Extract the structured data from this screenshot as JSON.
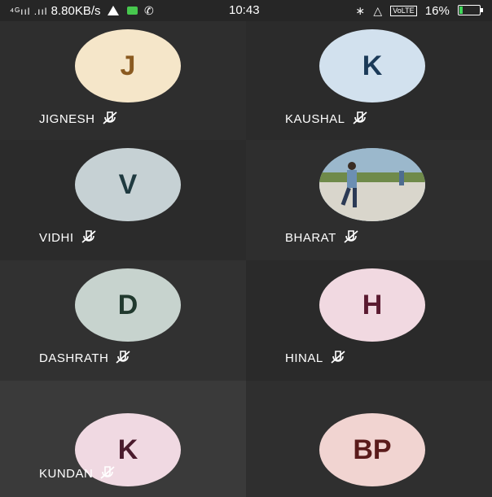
{
  "status_bar": {
    "signal_text": "⁴ᴳııl .ııl",
    "speed": "8.80KB/s",
    "time": "10:43",
    "volte": "VoLTE",
    "battery": "16%",
    "battery_level": 0.16,
    "icons": [
      "signal-icon",
      "warning-icon",
      "message-icon",
      "phone-icon",
      "bluetooth-icon",
      "mute-icon",
      "battery-icon"
    ]
  },
  "colors": {
    "dark_tile": "#2f2f2f",
    "darker_tile": "#2a2a2a"
  },
  "participants": [
    {
      "name": "JIGNESH",
      "initials": "J",
      "avatar_bg": "#f5e6c9",
      "avatar_fg": "#8a5a20",
      "tile_bg": "#2e2e2e",
      "muted": true
    },
    {
      "name": "KAUSHAL",
      "initials": "K",
      "avatar_bg": "#d2e1ee",
      "avatar_fg": "#1b3a58",
      "tile_bg": "#2b2b2b",
      "muted": true
    },
    {
      "name": "VIDHI",
      "initials": "V",
      "avatar_bg": "#c6d1d4",
      "avatar_fg": "#1f3a40",
      "tile_bg": "#2b2b2b",
      "muted": true
    },
    {
      "name": "BHARAT",
      "initials": "",
      "avatar_bg": "#87a7bd",
      "avatar_fg": "#ffffff",
      "tile_bg": "#2e2e2e",
      "muted": true,
      "photo": true
    },
    {
      "name": "DASHRATH",
      "initials": "D",
      "avatar_bg": "#c7d3ce",
      "avatar_fg": "#21392e",
      "tile_bg": "#313131",
      "muted": true
    },
    {
      "name": "HINAL",
      "initials": "H",
      "avatar_bg": "#f1d9e1",
      "avatar_fg": "#5a1a30",
      "tile_bg": "#2a2a2a",
      "muted": true
    },
    {
      "name": "KUNDAN",
      "initials": "K",
      "avatar_bg": "#f0d9e2",
      "avatar_fg": "#4a1b2d",
      "tile_bg": "#3a3a3a",
      "muted": true
    },
    {
      "name": "",
      "initials": "BP",
      "avatar_bg": "#f1d4d1",
      "avatar_fg": "#5a1b1b",
      "tile_bg": "#2f2f2f",
      "muted": false
    }
  ]
}
